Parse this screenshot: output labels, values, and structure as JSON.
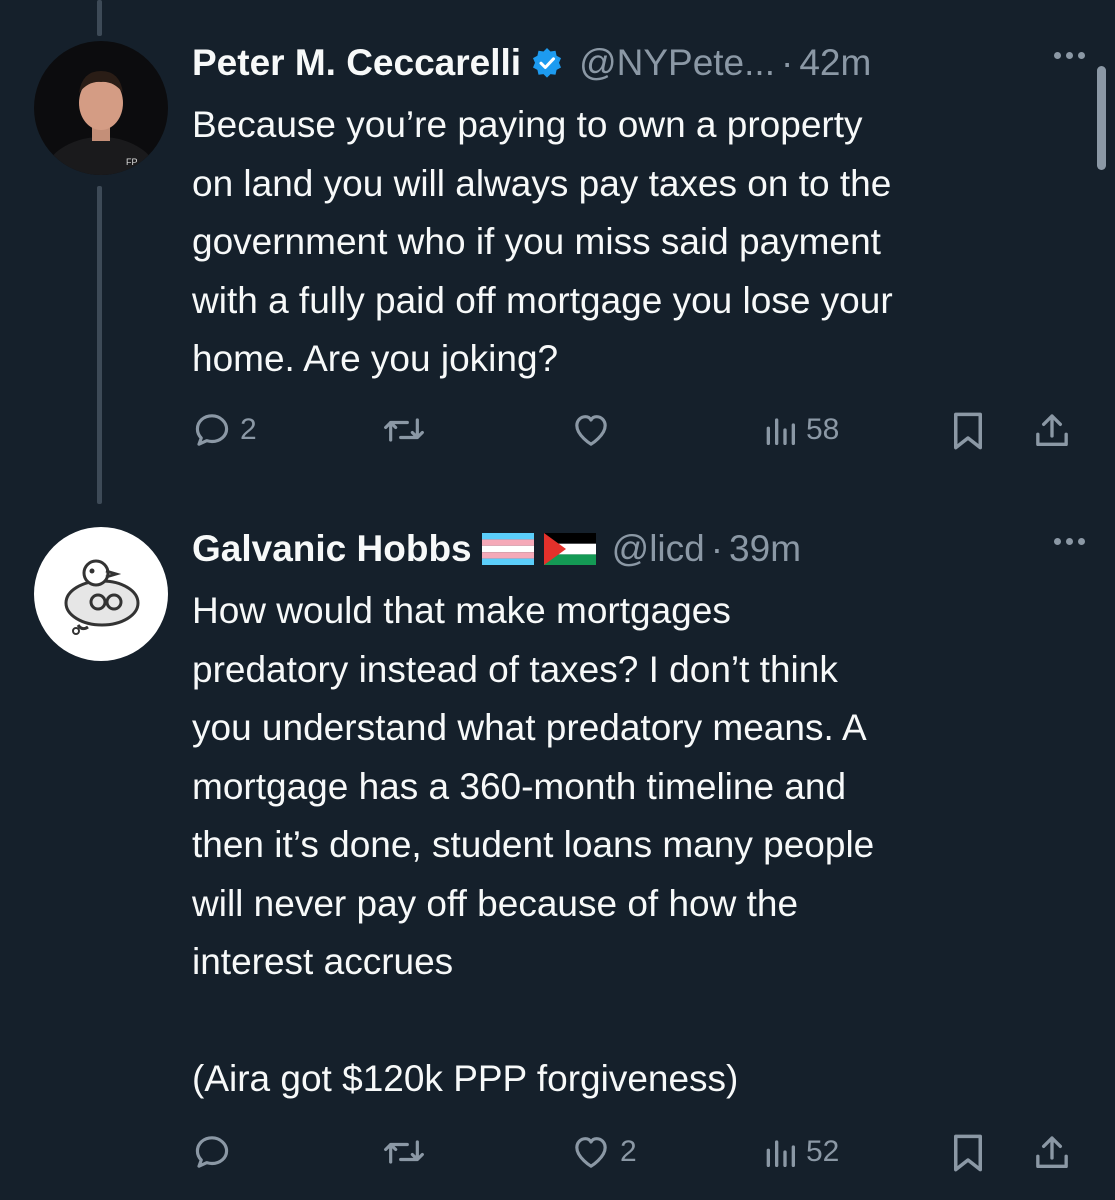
{
  "tweets": [
    {
      "display_name": "Peter M. Ceccarelli",
      "verified": true,
      "handle": "@NYPete...",
      "separator": "·",
      "time": "42m",
      "body": "Because you’re paying to own a property\non land you will always pay taxes on to the\ngovernment who if you miss said payment\nwith a fully paid off mortgage you lose your\nhome. Are you joking?",
      "avatar_text": "FP",
      "actions": {
        "reply_count": "2",
        "retweet_count": "",
        "like_count": "",
        "views_count": "58"
      }
    },
    {
      "display_name": "Galvanic Hobbs",
      "flags": [
        "transgender-flag",
        "palestine-flag"
      ],
      "handle": "@licd",
      "separator": "·",
      "time": "39m",
      "body": "How would that make mortgages\npredatory instead of taxes? I don’t think\nyou understand what predatory means. A\nmortgage has a 360-month timeline and\nthen it’s done, student loans many people\nwill never pay off because of how the\ninterest accrues\n\n(Aira got $120k PPP forgiveness)",
      "actions": {
        "reply_count": "",
        "retweet_count": "",
        "like_count": "2",
        "views_count": "52"
      }
    }
  ],
  "icons": {
    "reply": "reply-icon",
    "retweet": "retweet-icon",
    "like": "like-icon",
    "views": "views-icon",
    "bookmark": "bookmark-icon",
    "share": "share-icon",
    "verified": "verified-badge-icon",
    "more": "more-options-icon"
  },
  "colors": {
    "background": "#15202b",
    "text": "#f7f9f9",
    "secondary": "#8b98a5",
    "verified": "#1d9bf0",
    "thread_line": "#3d4a57"
  }
}
